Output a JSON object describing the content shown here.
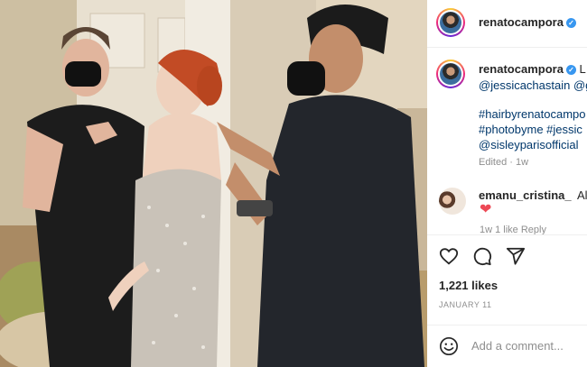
{
  "post": {
    "author": "renatocampora",
    "verified_mark": "✓",
    "caption": {
      "author": "renatocampora",
      "first_line_tail": "L",
      "tags_line1": "@jessicachastain @g",
      "hashtags_line1": "#hairbyrenatocampo",
      "hashtags_line2": "#photobyme #jessic",
      "tags_line3": "@sisleyparisofficial",
      "edited": "Edited · 1w"
    },
    "comment": {
      "user": "emanu_cristina_",
      "text": "Alw",
      "emoji": "❤",
      "meta": "1w    1 like    Reply"
    },
    "likes": "1,221 likes",
    "date": "JANUARY 11",
    "add_comment_placeholder": "Add a comment..."
  },
  "icons": {
    "like": "heart-icon",
    "comment": "comment-icon",
    "share": "share-icon",
    "emoji": "emoji-icon"
  }
}
